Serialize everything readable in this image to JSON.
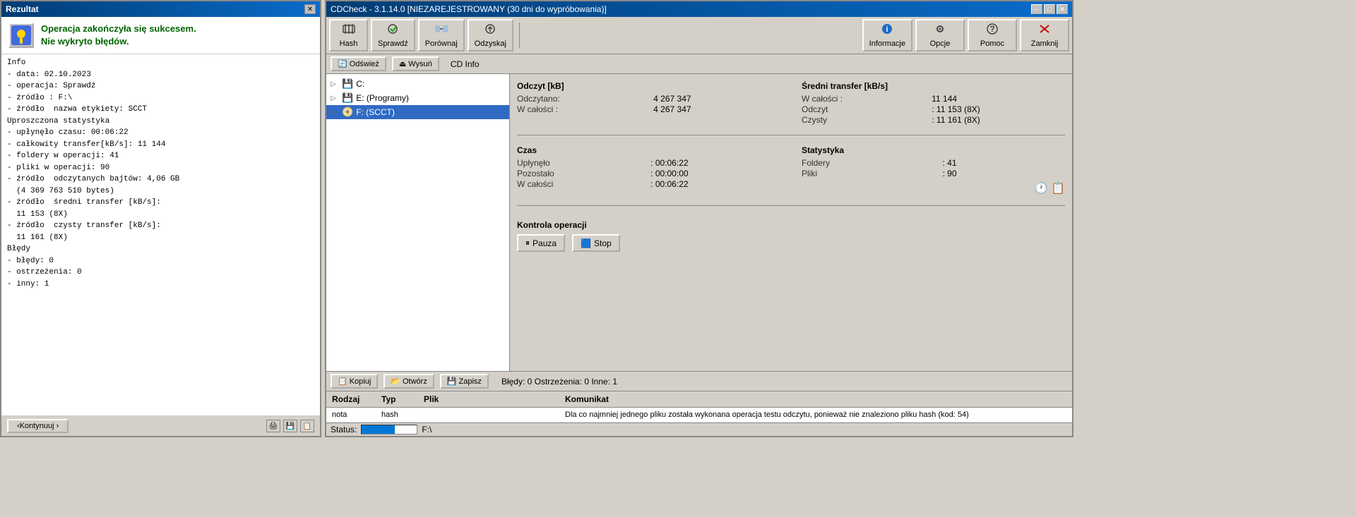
{
  "rezultat": {
    "title": "Rezultat",
    "success_line1": "Operacja zakończyła się sukcesem.",
    "success_line2": "Nie wykryto błędów.",
    "content": [
      "Info",
      "- data: 02.10.2023",
      "- operacja: Sprawdź",
      "- źródło : F:\\",
      "- źródło  nazwa etykiety: SCCT",
      "",
      "Uproszczona statystyka",
      "- upłynęło czasu: 00:06:22",
      "- całkowity transfer[kB/s]: 11 144",
      "- foldery w operacji: 41",
      "- pliki w operacji: 90",
      "- źródło  odczytanych bajtów: 4,06 GB",
      "  (4 369 763 510 bytes)",
      "- źródło  średni transfer [kB/s]:",
      "  11 153 (8X)",
      "- źródło  czysty transfer [kB/s]:",
      "  11 161 (8X)",
      "",
      "Błędy",
      "- błędy: 0",
      "- ostrzeżenia: 0",
      "- inny: 1"
    ],
    "continue_btn": "‹Kontynuuj ›"
  },
  "cdcheck": {
    "title": "CDCheck - 3.1.14.0 [NIEZAREJESTROWANY (30 dni do wypróbowania)]",
    "toolbar": {
      "hash_label": "Hash",
      "sprawdz_label": "Sprawdź",
      "porownaj_label": "Porównaj",
      "odzyskaj_label": "Odzyskaj",
      "informacje_label": "Informacje",
      "opcje_label": "Opcje",
      "pomoc_label": "Pomoc",
      "zamknij_label": "Zamknij"
    },
    "cdinfo_bar": {
      "odswiez": "Odśwież",
      "wysun": "Wysuń",
      "cd_info": "CD Info"
    },
    "tree": {
      "items": [
        {
          "label": "C:",
          "icon": "💾",
          "level": 0
        },
        {
          "label": "E: (Programy)",
          "icon": "💾",
          "level": 0
        },
        {
          "label": "F: (SCCT)",
          "icon": "📀",
          "level": 0
        }
      ]
    },
    "stats": {
      "odczyt_header": "Odczyt [kB]",
      "sredni_header": "Średni transfer [kB/s]",
      "odczytano_label": "Odczytano:",
      "odczytano_value": "4 267 347",
      "w_calosci_label": "W całości :",
      "w_calosci_value": "4 267 347",
      "w_calosci2_label": "W całości :",
      "w_calosci2_value": "11 144",
      "odczyt_label": "Odczyt",
      "odczyt_value": ": 11 153 (8X)",
      "czysty_label": "Czysty",
      "czysty_value": ": 11 161 (8X)",
      "czas_header": "Czas",
      "statystyka_header": "Statystyka",
      "uplynelo_label": "Upłynęło",
      "uplynelo_value": ": 00:06:22",
      "pozostalo_label": "Pozostało",
      "pozostalo_value": ": 00:00:00",
      "w_calosci3_label": "W całości",
      "w_calosci3_value": ": 00:06:22",
      "foldery_label": "Foldery",
      "foldery_value": ": 41",
      "pliki_label": "Pliki",
      "pliki_value": ": 90",
      "kontrola_header": "Kontrola operacji",
      "pauza_label": "Pauza",
      "stop_label": "Stop"
    },
    "log": {
      "copy_label": "Kopiuj",
      "open_label": "Otwórz",
      "save_label": "Zapisz",
      "status_text": "Błędy: 0  Ostrzeżenia: 0  Inne: 1",
      "columns": {
        "rodzaj": "Rodzaj",
        "typ": "Typ",
        "plik": "Plik",
        "komunikat": "Komunikat"
      },
      "rows": [
        {
          "rodzaj": "nota",
          "typ": "hash",
          "plik": "",
          "komunikat": "Dla co najmniej jednego pliku została wykonana operacja testu odczytu, ponieważ nie znaleziono pliku hash (kod: 54)"
        }
      ]
    },
    "status": {
      "label": "Status:",
      "path": "F:\\"
    }
  }
}
